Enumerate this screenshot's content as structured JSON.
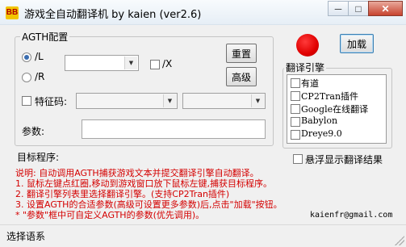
{
  "window": {
    "icon_text": "BB",
    "title": "游戏全自动翻译机  by kaien (ver2.6)",
    "buttons": {
      "minimize": "─",
      "maximize": "□",
      "close": "✕"
    }
  },
  "agth": {
    "group_label": "AGTH配置",
    "radio_l": {
      "label": "/L",
      "selected": true
    },
    "radio_r": {
      "label": "/R",
      "selected": false
    },
    "check_x": {
      "label": "/X",
      "checked": false
    },
    "feature_code": {
      "label": "特征码:",
      "checked": false,
      "value": ""
    },
    "params": {
      "label": "参数:",
      "value": ""
    }
  },
  "buttons": {
    "reset": "重置",
    "advanced": "高级",
    "load": "加载"
  },
  "status_light": {
    "color": "#e00000"
  },
  "engine": {
    "group_label": "翻译引擎",
    "items": [
      {
        "label": "有道",
        "checked": false
      },
      {
        "label": "CP2Tran插件",
        "checked": false
      },
      {
        "label": "Google在线翻译",
        "checked": false
      },
      {
        "label": "Babylon",
        "checked": false
      },
      {
        "label": "Dreye9.0",
        "checked": false
      }
    ]
  },
  "target_program": {
    "label": "目标程序:"
  },
  "floating_display": {
    "label": "悬浮显示翻译结果",
    "checked": false
  },
  "description": {
    "color": "#d40000",
    "lines": [
      "说明: 自动调用AGTH捕获游戏文本并提交翻译引擎自动翻译。",
      "1. 鼠标左键点红圈,移动到游戏窗口放下鼠标左键,捕获目标程序。",
      "2. 翻译引擎列表里选择翻译引擎。(支持CP2Tran插件)",
      "3. 设置AGTH的合适参数(高级可设置更多参数)后,点击\"加载\"按钮。",
      "* \"参数\"框中可自定义AGTH的参数(优先调用)。"
    ]
  },
  "email": "kaienfr@gmail.com",
  "status_bar": {
    "text": "选择语系"
  }
}
